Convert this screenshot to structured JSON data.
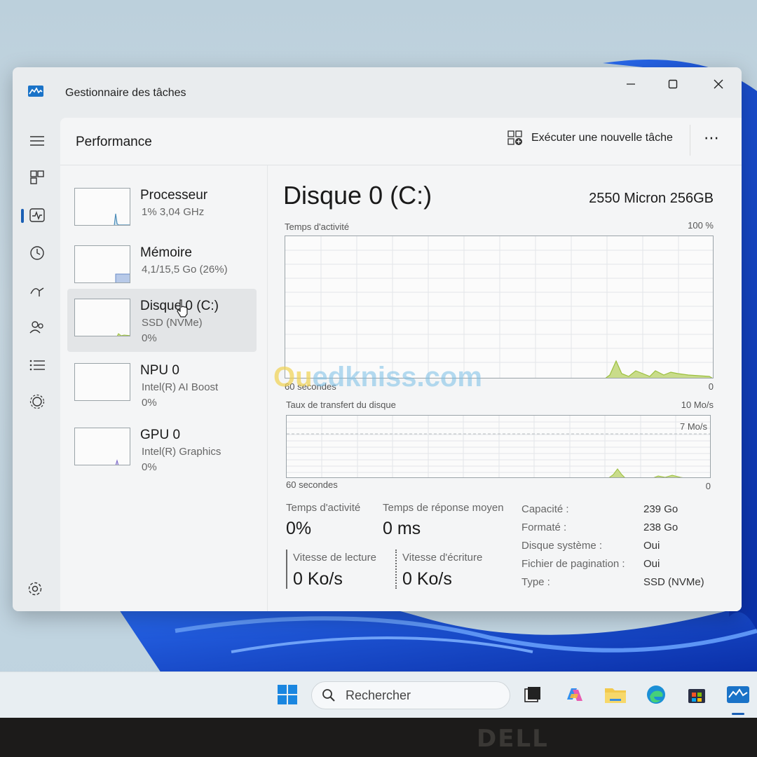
{
  "window": {
    "title": "Gestionnaire des tâches"
  },
  "header": {
    "page_title": "Performance",
    "run_task_label": "Exécuter une nouvelle tâche",
    "more_label": "⋯"
  },
  "perf_items": [
    {
      "name": "Processeur",
      "sub": "1% 3,04 GHz",
      "sub2": ""
    },
    {
      "name": "Mémoire",
      "sub": "4,1/15,5 Go (26%)",
      "sub2": ""
    },
    {
      "name": "Disque 0 (C:)",
      "sub": "SSD (NVMe)",
      "sub2": "0%"
    },
    {
      "name": "NPU 0",
      "sub": "Intel(R) AI Boost",
      "sub2": "0%"
    },
    {
      "name": "GPU 0",
      "sub": "Intel(R) Graphics",
      "sub2": "0%"
    }
  ],
  "detail": {
    "title": "Disque 0 (C:)",
    "model": "2550 Micron 256GB",
    "graph1": {
      "label": "Temps d'activité",
      "max": "100 %",
      "time": "60 secondes",
      "min": "0"
    },
    "graph2": {
      "label": "Taux de transfert du disque",
      "max": "10 Mo/s",
      "inner": "7 Mo/s",
      "time": "60 secondes",
      "min": "0"
    },
    "stats": {
      "active_label": "Temps d'activité",
      "active_value": "0%",
      "response_label": "Temps de réponse moyen",
      "response_value": "0 ms",
      "read_label": "Vitesse de lecture",
      "read_value": "0 Ko/s",
      "write_label": "Vitesse d'écriture",
      "write_value": "0 Ko/s"
    },
    "properties": [
      {
        "key": "Capacité :",
        "value": "239 Go"
      },
      {
        "key": "Formaté :",
        "value": "238 Go"
      },
      {
        "key": "Disque système :",
        "value": "Oui"
      },
      {
        "key": "Fichier de pagination :",
        "value": "Oui"
      },
      {
        "key": "Type :",
        "value": "SSD (NVMe)"
      }
    ]
  },
  "taskbar": {
    "search_placeholder": "Rechercher"
  },
  "watermark": {
    "part1": "Ou",
    "part2": "ed",
    "part3": "kniss.com"
  },
  "bezel": {
    "logo": "DELL"
  },
  "colors": {
    "accent": "#1a5fb4",
    "graph_fill": "#c9dc8a",
    "graph_line": "#9bbf3e",
    "grid": "#e3e6e8"
  }
}
